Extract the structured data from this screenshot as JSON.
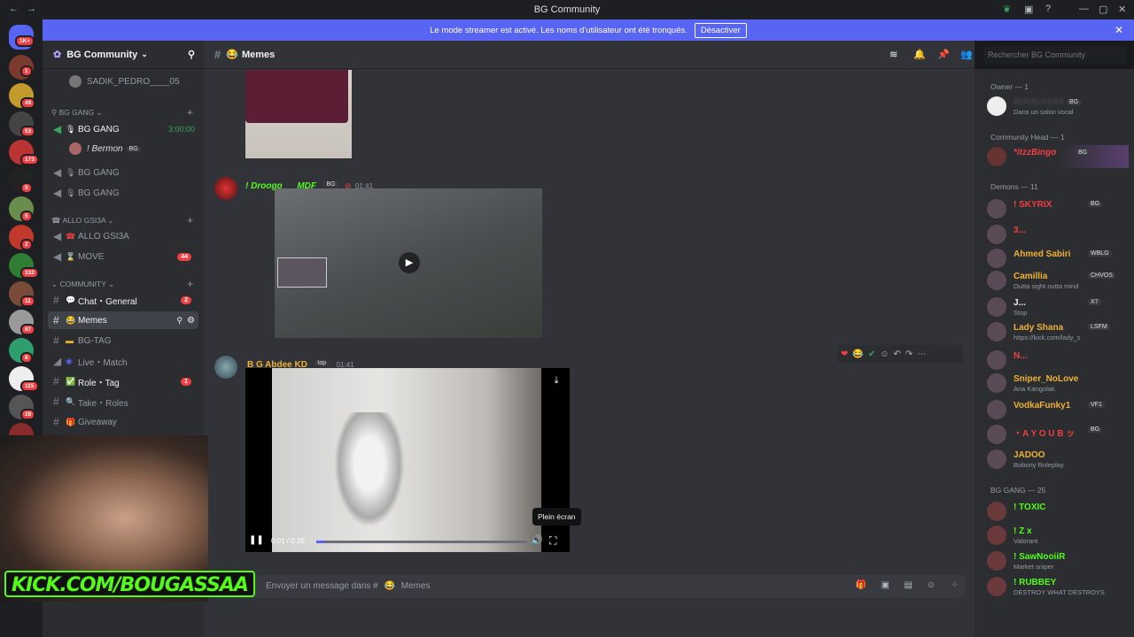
{
  "titlebar": {
    "title": "BG Community"
  },
  "banner": {
    "text": "Le mode streamer est activé. Les noms d'utilisateur ont été tronqués.",
    "button": "Désactiver"
  },
  "guilds": {
    "badges": [
      "1K+",
      "1",
      "49",
      "53",
      "173",
      "5",
      "5",
      "2",
      "332",
      "11",
      "87",
      "8",
      "115",
      "28"
    ]
  },
  "server": {
    "name": "BG Community"
  },
  "sidebar": {
    "voice_user_top": "SADIK_PEDRO____05",
    "cat_bg_gang": "BG GANG",
    "ch_bg_gang_1": "BG GANG",
    "ch_bg_gang_1_time": "3:00:00",
    "voice_user_bermon": "! Bermon",
    "voice_user_bermon_tag": "BG",
    "ch_bg_gang_2": "BG GANG",
    "ch_bg_gang_3": "BG GANG",
    "cat_allo": "ALLO GSI3A",
    "ch_allo": "ALLO GSI3A",
    "ch_move": "MOVE",
    "ch_move_badge": "44",
    "cat_community": "COMMUNITY",
    "ch_chat": "Chat・General",
    "ch_chat_badge": "2",
    "ch_memes": "Memes",
    "ch_bgtag": "BG-TAG",
    "ch_live": "Live・Match",
    "ch_role": "Role・Tag",
    "ch_role_badge": "1",
    "ch_take": "Take・Roles",
    "ch_giveaway": "Giveaway",
    "extra_badge": "1"
  },
  "channel": {
    "name": "Memes",
    "search_placeholder": "Rechercher BG Community"
  },
  "messages": [
    {
      "author": "! Droogo___MDF",
      "tag": "BG",
      "time": "01:41"
    },
    {
      "author": "B G Abdee KD",
      "tag": "top",
      "time": "01:41"
    }
  ],
  "video": {
    "time": "0:01 / 0:26",
    "tooltip": "Plein écran",
    "progress": 0.04
  },
  "input": {
    "placeholder": "Envoyer un message dans #",
    "channel": "Memes"
  },
  "overlay": {
    "kick": "KICK.COM/BOUGASSAA"
  },
  "members": {
    "cat_owner": "Owner — 1",
    "owner_name": "BOUGASSA",
    "owner_tag": "BG",
    "owner_status": "Dans un salon vocal",
    "cat_head": "Community Head — 1",
    "head_name": "*itzzBingo",
    "head_tag": "BG",
    "cat_demons": "Demons — 11",
    "list": [
      {
        "name": "! SKYRIX",
        "tag": "BG",
        "status": "",
        "color": "#f23f43"
      },
      {
        "name": "3...",
        "tag": "",
        "status": "",
        "color": "#f23f43"
      },
      {
        "name": "Ahmed Sabiri",
        "tag": "WBLG",
        "status": "",
        "color": "#f0b232"
      },
      {
        "name": "Camillia",
        "tag": "CHVOS",
        "status": "Outta sight outta mind",
        "color": "#f0b232"
      },
      {
        "name": "J...",
        "tag": "X7",
        "status": "Stop",
        "color": "#f2f3f5"
      },
      {
        "name": "Lady Shana",
        "tag": "LSFM",
        "status": "https://kick.com/lady_s",
        "color": "#f0b232"
      },
      {
        "name": "N...",
        "tag": "",
        "status": "",
        "color": "#f23f43"
      },
      {
        "name": "Sniper_NoLove",
        "tag": "",
        "status": "Ana Kangolak",
        "color": "#f0b232"
      },
      {
        "name": "VodkaFunky1",
        "tag": "VF1",
        "status": "",
        "color": "#f0b232"
      },
      {
        "name": "・A Y O U B ッ",
        "tag": "BG",
        "status": "",
        "color": "#f23f43"
      },
      {
        "name": "JADOO",
        "tag": "",
        "status": "Bobony Roleplay",
        "color": "#f0b232"
      }
    ],
    "cat_gang": "BG GANG — 25",
    "gang": [
      {
        "name": "! TOXIC",
        "status": "",
        "color": "#53fc18"
      },
      {
        "name": "! Z x",
        "status": "Valorant",
        "color": "#53fc18"
      },
      {
        "name": "! SawNooiiR",
        "status": "Market sniper",
        "color": "#53fc18"
      },
      {
        "name": "! RUBBEY",
        "status": "DESTROY WHAT DESTROYS",
        "color": "#53fc18"
      }
    ]
  },
  "colors": {
    "accent": "#5865f2",
    "bg": "#313338",
    "sidebar": "#2b2d31"
  }
}
